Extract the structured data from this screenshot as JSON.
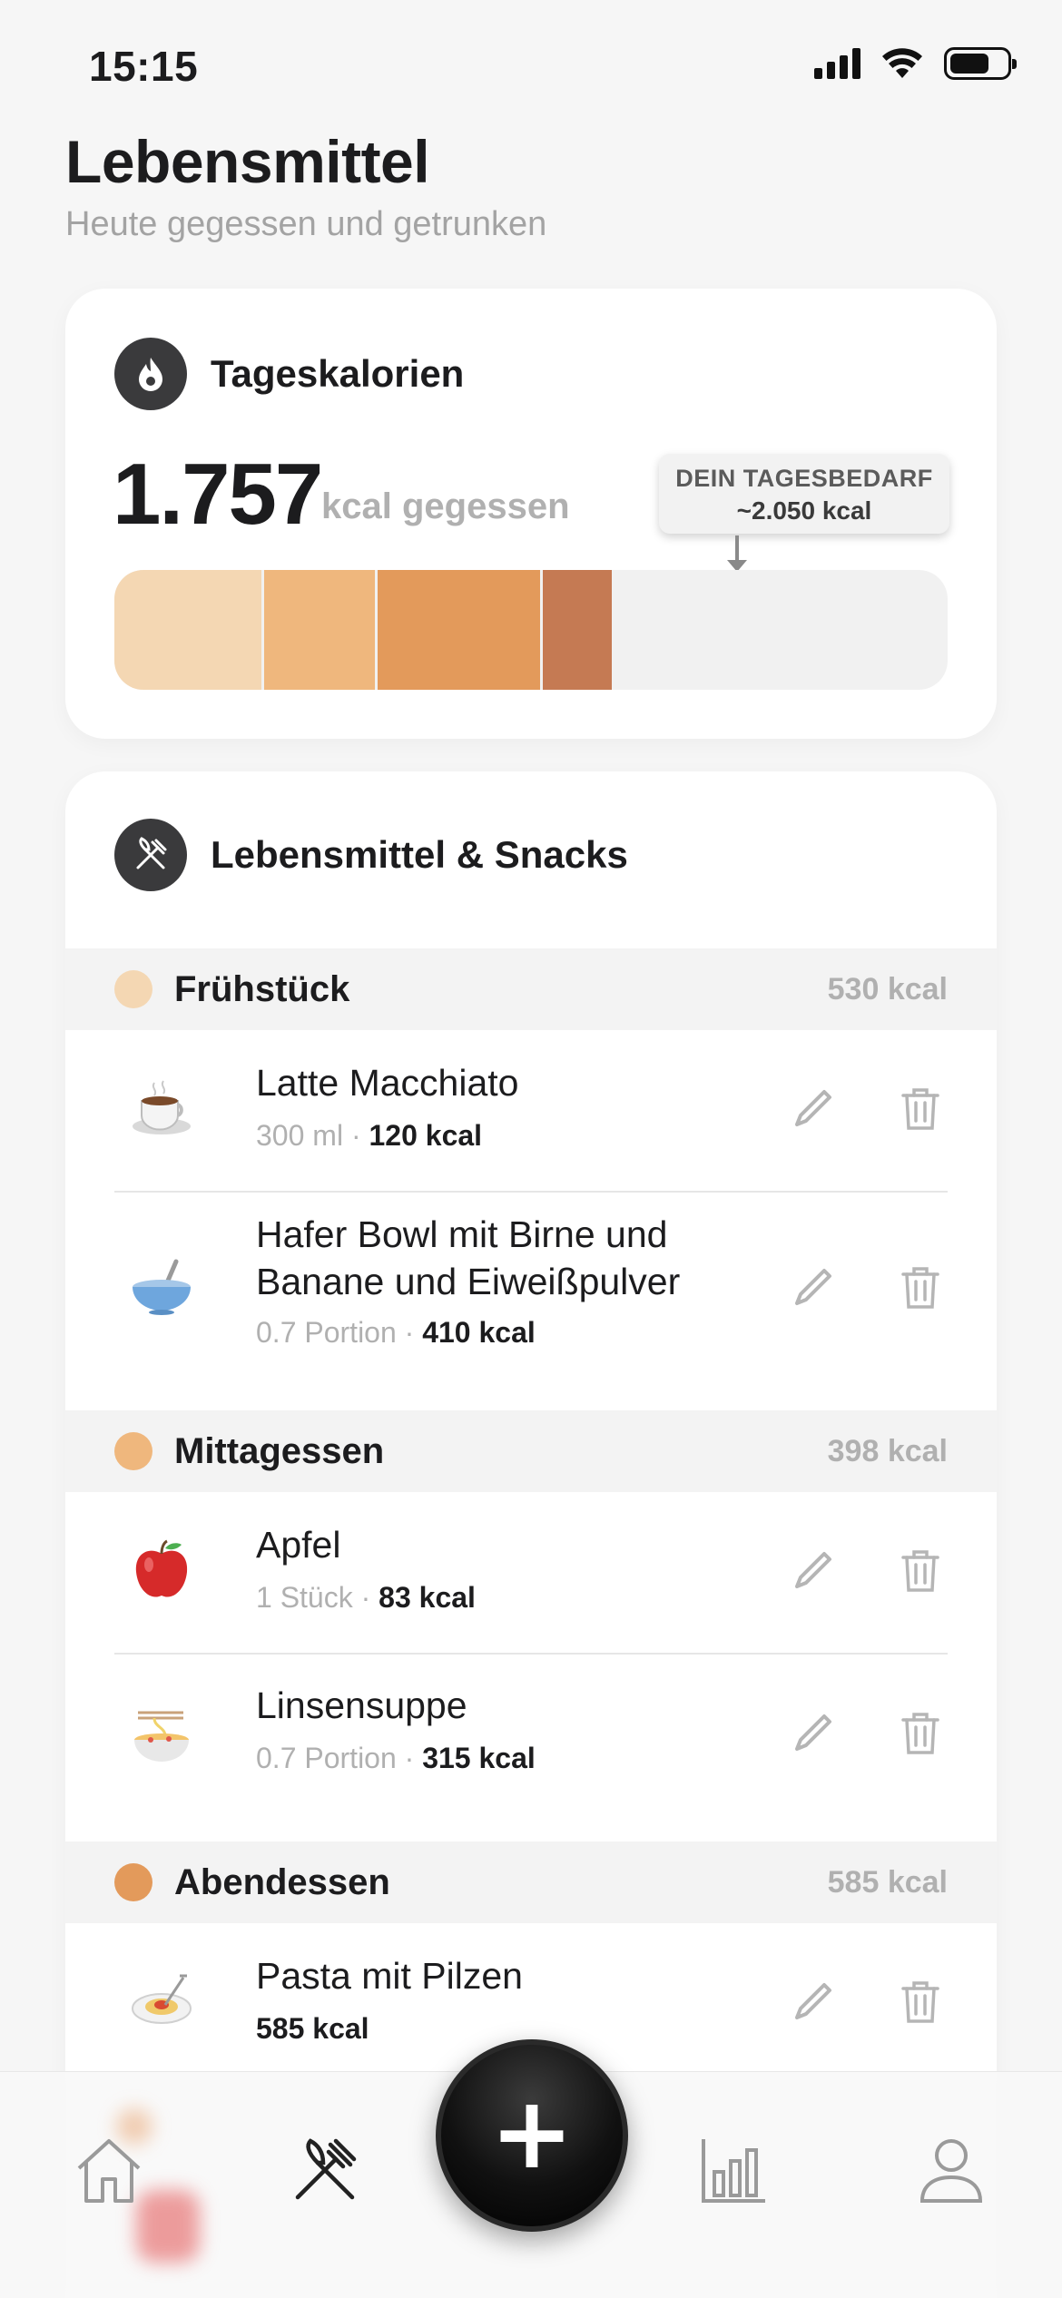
{
  "status_bar": {
    "time": "15:15"
  },
  "header": {
    "title": "Lebensmittel",
    "subtitle": "Heute gegessen und getrunken"
  },
  "calories_card": {
    "title": "Tageskalorien",
    "icon": "flame-icon",
    "eaten_value": "1.757",
    "eaten_unit": "kcal gegessen",
    "need_label": "DEIN TAGESBEDARF",
    "need_value": "~2.050 kcal",
    "segments": [
      {
        "meal": "Frühstück",
        "kcal": 530,
        "color": "#f4d7b3"
      },
      {
        "meal": "Mittagessen",
        "kcal": 398,
        "color": "#efb77d"
      },
      {
        "meal": "Abendessen",
        "kcal": 585,
        "color": "#e39a5b"
      },
      {
        "meal": "Snacks",
        "kcal": 244,
        "color": "#c57a53"
      }
    ],
    "daily_need_kcal": 2050
  },
  "food_card": {
    "title": "Lebensmittel & Snacks",
    "icon": "fork-knife-icon",
    "sections": [
      {
        "name": "Frühstück",
        "kcal": "530 kcal",
        "color": "#f4d7b3",
        "items": [
          {
            "emoji": "coffee-cup-icon",
            "name": "Latte Macchiato",
            "amount": "300 ml",
            "kcal": "120 kcal"
          },
          {
            "emoji": "bowl-icon",
            "name": "Hafer Bowl mit Birne und Banane und Eiweißpulver",
            "amount": "0.7 Portion",
            "kcal": "410 kcal"
          }
        ]
      },
      {
        "name": "Mittagessen",
        "kcal": "398 kcal",
        "color": "#efb77d",
        "items": [
          {
            "emoji": "apple-icon",
            "name": "Apfel",
            "amount": "1 Stück",
            "kcal": "83 kcal"
          },
          {
            "emoji": "soup-icon",
            "name": "Linsensuppe",
            "amount": "0.7 Portion",
            "kcal": "315 kcal"
          }
        ]
      },
      {
        "name": "Abendessen",
        "kcal": "585 kcal",
        "color": "#e39a5b",
        "items": [
          {
            "emoji": "pasta-icon",
            "name": "Pasta mit Pilzen",
            "amount": "",
            "kcal": "585 kcal"
          }
        ]
      }
    ]
  },
  "tab_bar": {
    "tabs": [
      "home-icon",
      "fork-knife-icon",
      "add-icon",
      "chart-icon",
      "profile-icon"
    ],
    "active": "fork-knife-icon",
    "fab_label": "+"
  }
}
